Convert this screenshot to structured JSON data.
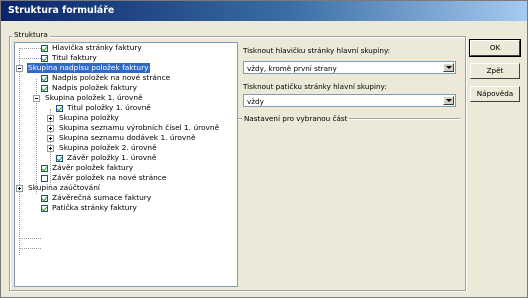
{
  "window": {
    "title": "Struktura formuláře"
  },
  "structure": {
    "legend": "Struktura",
    "items": [
      {
        "label": "Hlavička stránky faktury",
        "checked": true
      },
      {
        "label": "Titul faktury",
        "checked": true
      },
      {
        "label": "Skupina nadpisu položek faktury",
        "expanded": true,
        "selected": true
      },
      {
        "label": "Nadpis položek na nové stránce",
        "checked": true
      },
      {
        "label": "Nadpis položek faktury",
        "checked": true
      },
      {
        "label": "Skupina položek 1. úrovně",
        "expanded": true
      },
      {
        "label": "Titul položky 1. úrovně",
        "checked": true
      },
      {
        "label": "Skupina položky",
        "expanded": false
      },
      {
        "label": "Skupina seznamu výrobních čísel 1. úrovně",
        "expanded": false
      },
      {
        "label": "Skupina seznamu dodávek 1. úrovně",
        "expanded": false
      },
      {
        "label": "Skupina položek 2. úrovně",
        "expanded": false
      },
      {
        "label": "Závěr položky 1. úrovně",
        "checked": true
      },
      {
        "label": "Závěr položek faktury",
        "checked": true
      },
      {
        "label": "Závěr položek na nové stránce",
        "checked": false
      },
      {
        "label": "Skupina zaúčtování",
        "expanded": false
      },
      {
        "label": "Závěrečná sumace faktury",
        "checked": true
      },
      {
        "label": "Patička stránky faktury",
        "checked": true
      }
    ]
  },
  "header_print": {
    "label": "Tisknout hlavičku stránky hlavní skupiny:",
    "value": "vždy, kromě první strany"
  },
  "footer_print": {
    "label": "Tisknout patičku stránky hlavní skupiny:",
    "value": "vždy"
  },
  "settings": {
    "legend": "Nastavení pro vybranou část"
  },
  "buttons": {
    "ok": "OK",
    "back": "Zpět",
    "help": "Nápověda"
  }
}
